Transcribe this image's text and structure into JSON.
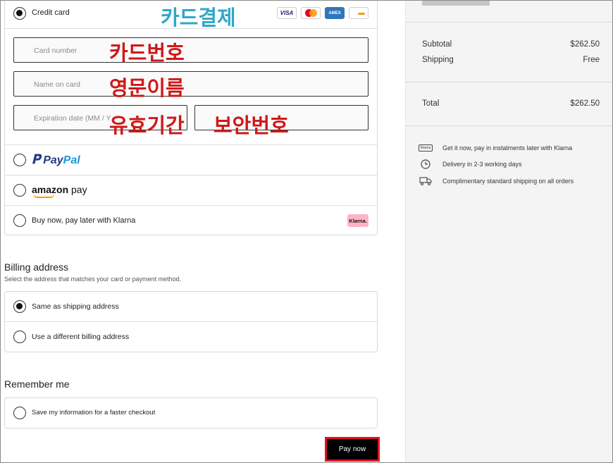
{
  "payment": {
    "credit_card": {
      "label": "Credit card",
      "selected": true,
      "overlay": "카드결제",
      "logos": [
        "VISA",
        "Mastercard",
        "AMEX",
        "Discover"
      ],
      "amex_text": "AMEX",
      "visa_text": "VISA"
    },
    "fields": {
      "card_number": {
        "placeholder": "Card number",
        "overlay": "카드번호"
      },
      "name_on_card": {
        "placeholder": "Name on card",
        "overlay": "영문이름"
      },
      "expiration": {
        "placeholder": "Expiration date (MM / YY)",
        "overlay": "유효기간"
      },
      "security_code": {
        "placeholder": "",
        "overlay": "보안번호"
      }
    },
    "paypal": {
      "part1": "Pay",
      "part2": "Pal",
      "selected": false
    },
    "amazon_pay": {
      "brand": "amazon",
      "suffix": " pay",
      "selected": false
    },
    "klarna": {
      "label": "Buy now, pay later with Klarna",
      "badge": "Klarna.",
      "selected": false
    }
  },
  "billing": {
    "title": "Billing address",
    "subtitle": "Select the address that matches your card or payment method.",
    "options": [
      {
        "label": "Same as shipping address",
        "selected": true
      },
      {
        "label": "Use a different billing address",
        "selected": false
      }
    ]
  },
  "remember": {
    "title": "Remember me",
    "option": "Save my information for a faster checkout"
  },
  "pay_button": "Pay now",
  "summary": {
    "subtotal_label": "Subtotal",
    "subtotal_value": "$262.50",
    "shipping_label": "Shipping",
    "shipping_value": "Free",
    "total_label": "Total",
    "total_value": "$262.50"
  },
  "perks": [
    {
      "icon": "klarna-icon",
      "icon_text": "Klarna",
      "text": "Get it now, pay in instalments later with Klarna"
    },
    {
      "icon": "clock-icon",
      "text": "Delivery in 2-3 working days"
    },
    {
      "icon": "truck-icon",
      "text": "Complimentary standard shipping on all orders"
    }
  ],
  "colors": {
    "overlay_red": "#d01818",
    "overlay_teal": "#31a7c7",
    "pay_button_border": "#e0141e"
  }
}
